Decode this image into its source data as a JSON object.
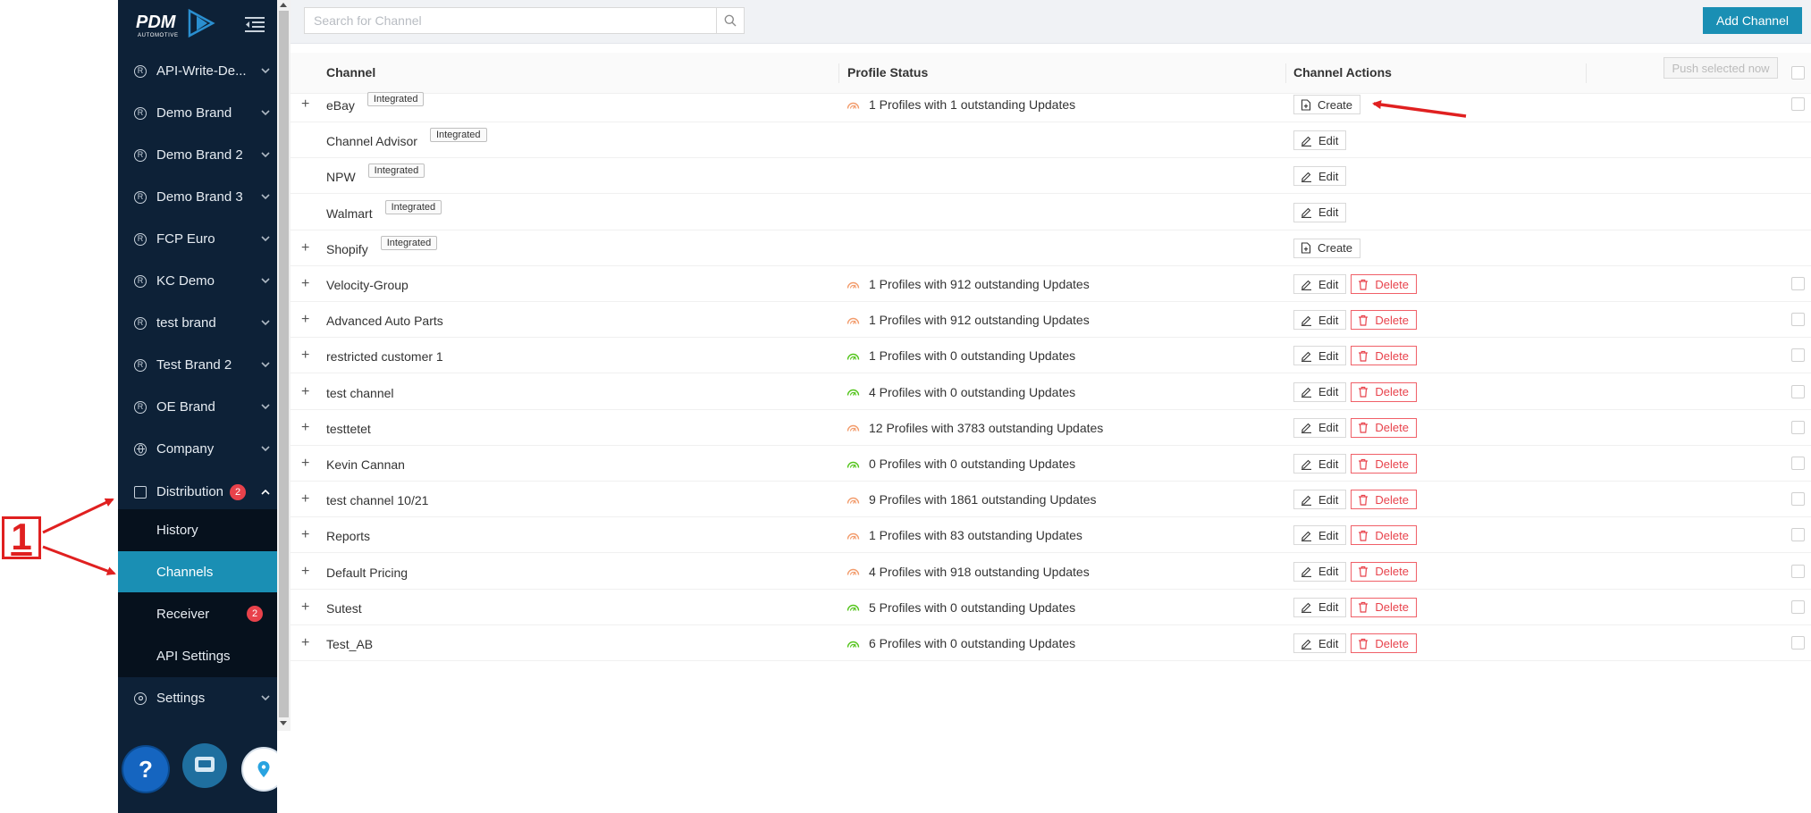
{
  "annotation": {
    "number": "1"
  },
  "logo": {
    "brand": "PDM",
    "sub": "AUTOMOTIVE"
  },
  "sidebar": {
    "items": [
      {
        "label": "API-Write-De...",
        "icon": "registered-icon"
      },
      {
        "label": "Demo Brand",
        "icon": "registered-icon"
      },
      {
        "label": "Demo Brand 2",
        "icon": "registered-icon"
      },
      {
        "label": "Demo Brand 3",
        "icon": "registered-icon"
      },
      {
        "label": "FCP Euro",
        "icon": "registered-icon"
      },
      {
        "label": "KC Demo",
        "icon": "registered-icon"
      },
      {
        "label": "test brand",
        "icon": "registered-icon"
      },
      {
        "label": "Test Brand 2",
        "icon": "registered-icon"
      },
      {
        "label": "OE Brand",
        "icon": "registered-icon"
      },
      {
        "label": "Company",
        "icon": "globe-icon"
      }
    ],
    "distribution": {
      "label": "Distribution",
      "badge": "2"
    },
    "submenu": [
      {
        "label": "History"
      },
      {
        "label": "Channels",
        "active": true
      },
      {
        "label": "Receiver",
        "badge": "2"
      },
      {
        "label": "API Settings"
      }
    ],
    "settings": {
      "label": "Settings"
    },
    "help_label": "?"
  },
  "search": {
    "placeholder": "Search for Channel",
    "value": ""
  },
  "toolbar": {
    "add_channel_label": "Add Channel",
    "push_label": "Push selected now"
  },
  "columns": {
    "channel": "Channel",
    "profile_status": "Profile Status",
    "channel_actions": "Channel Actions"
  },
  "labels": {
    "integrated": "Integrated",
    "create": "Create",
    "edit": "Edit",
    "delete": "Delete",
    "expand": "+"
  },
  "colors": {
    "accent": "#1a8fb4",
    "sidebar": "#0d2137",
    "danger": "#e8424b",
    "status_warn": "#f29b6b",
    "status_ok": "#52c41a"
  },
  "rows": [
    {
      "name": "eBay",
      "expand": true,
      "integrated": true,
      "status": "1 Profiles with 1 outstanding Updates",
      "state": "warn",
      "actions": [
        "create"
      ],
      "checkbox": true
    },
    {
      "name": "Channel Advisor",
      "expand": false,
      "integrated": true,
      "status": "",
      "state": "",
      "actions": [
        "edit"
      ],
      "checkbox": false
    },
    {
      "name": "NPW",
      "expand": false,
      "integrated": true,
      "status": "",
      "state": "",
      "actions": [
        "edit"
      ],
      "checkbox": false
    },
    {
      "name": "Walmart",
      "expand": false,
      "integrated": true,
      "status": "",
      "state": "",
      "actions": [
        "edit"
      ],
      "checkbox": false
    },
    {
      "name": "Shopify",
      "expand": true,
      "integrated": true,
      "status": "",
      "state": "",
      "actions": [
        "create"
      ],
      "checkbox": false
    },
    {
      "name": "Velocity-Group",
      "expand": true,
      "integrated": false,
      "status": "1 Profiles with 912 outstanding Updates",
      "state": "warn",
      "actions": [
        "edit",
        "delete"
      ],
      "checkbox": true
    },
    {
      "name": "Advanced Auto Parts",
      "expand": true,
      "integrated": false,
      "status": "1 Profiles with 912 outstanding Updates",
      "state": "warn",
      "actions": [
        "edit",
        "delete"
      ],
      "checkbox": true
    },
    {
      "name": "restricted customer 1",
      "expand": true,
      "integrated": false,
      "status": "1 Profiles with 0 outstanding Updates",
      "state": "ok",
      "actions": [
        "edit",
        "delete"
      ],
      "checkbox": true
    },
    {
      "name": "test channel",
      "expand": true,
      "integrated": false,
      "status": "4 Profiles with 0 outstanding Updates",
      "state": "ok",
      "actions": [
        "edit",
        "delete"
      ],
      "checkbox": true
    },
    {
      "name": "testtetet",
      "expand": true,
      "integrated": false,
      "status": "12 Profiles with 3783 outstanding Updates",
      "state": "warn",
      "actions": [
        "edit",
        "delete"
      ],
      "checkbox": true
    },
    {
      "name": "Kevin Cannan",
      "expand": true,
      "integrated": false,
      "status": "0 Profiles with 0 outstanding Updates",
      "state": "ok",
      "actions": [
        "edit",
        "delete"
      ],
      "checkbox": true
    },
    {
      "name": "test channel 10/21",
      "expand": true,
      "integrated": false,
      "status": "9 Profiles with 1861 outstanding Updates",
      "state": "warn",
      "actions": [
        "edit",
        "delete"
      ],
      "checkbox": true
    },
    {
      "name": "Reports",
      "expand": true,
      "integrated": false,
      "status": "1 Profiles with 83 outstanding Updates",
      "state": "warn",
      "actions": [
        "edit",
        "delete"
      ],
      "checkbox": true
    },
    {
      "name": "Default Pricing",
      "expand": true,
      "integrated": false,
      "status": "4 Profiles with 918 outstanding Updates",
      "state": "warn",
      "actions": [
        "edit",
        "delete"
      ],
      "checkbox": true
    },
    {
      "name": "Sutest",
      "expand": true,
      "integrated": false,
      "status": "5 Profiles with 0 outstanding Updates",
      "state": "ok",
      "actions": [
        "edit",
        "delete"
      ],
      "checkbox": true
    },
    {
      "name": "Test_AB",
      "expand": true,
      "integrated": false,
      "status": "6 Profiles with 0 outstanding Updates",
      "state": "ok",
      "actions": [
        "edit",
        "delete"
      ],
      "checkbox": true
    }
  ]
}
